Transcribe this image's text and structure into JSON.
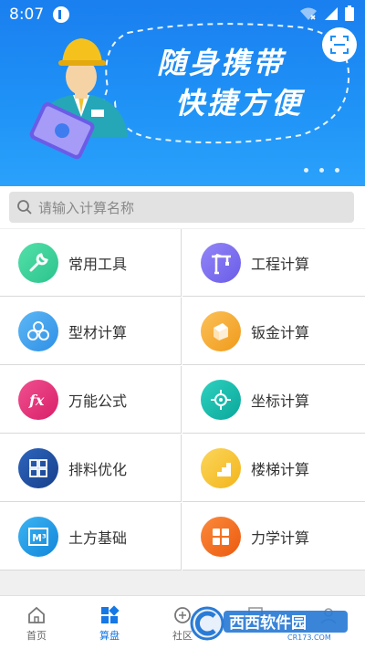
{
  "status_bar": {
    "time": "8:07"
  },
  "banner": {
    "slogan_line1": "随身携带",
    "slogan_line2": "快捷方便",
    "carousel_dots": 3
  },
  "search": {
    "placeholder": "请输入计算名称"
  },
  "tools": [
    {
      "label": "常用工具",
      "icon": "wrench-icon",
      "color": "#3ccf9a"
    },
    {
      "label": "工程计算",
      "icon": "crane-icon",
      "color": "#7a6df0"
    },
    {
      "label": "型材计算",
      "icon": "pipes-icon",
      "color": "#3a9df0"
    },
    {
      "label": "钣金计算",
      "icon": "sheet-metal-icon",
      "color": "#f5a623"
    },
    {
      "label": "万能公式",
      "icon": "function-icon",
      "color": "#e5307a"
    },
    {
      "label": "坐标计算",
      "icon": "coordinate-icon",
      "color": "#14b8a6"
    },
    {
      "label": "排料优化",
      "icon": "layout-grid-icon",
      "color": "#1d4fa3"
    },
    {
      "label": "楼梯计算",
      "icon": "stairs-icon",
      "color": "#f5c12e"
    },
    {
      "label": "土方基础",
      "icon": "cube-m3-icon",
      "color": "#1a9ae6"
    },
    {
      "label": "力学计算",
      "icon": "blocks-icon",
      "color": "#f26a1b"
    }
  ],
  "tabbar": {
    "tabs": [
      {
        "label": "首页",
        "icon": "home-icon",
        "active": false
      },
      {
        "label": "算盘",
        "icon": "abacus-icon",
        "active": true
      },
      {
        "label": "社区",
        "icon": "community-icon",
        "active": false
      }
    ]
  },
  "watermark": {
    "text": "西西软件园",
    "subtext": "CR173.COM"
  },
  "colors": {
    "primary": "#1677e6",
    "banner": "#1e90f6"
  }
}
